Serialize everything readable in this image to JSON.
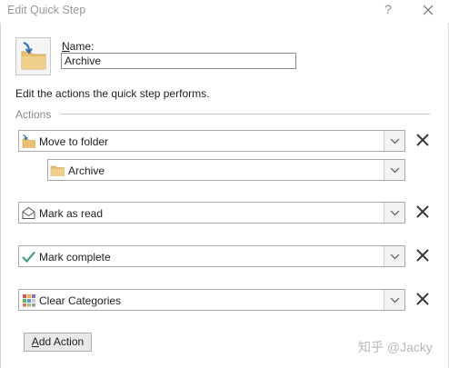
{
  "window": {
    "title": "Edit Quick Step",
    "help_label": "?"
  },
  "quick_step": {
    "icon": "move-to-folder-icon",
    "name_label": "Name:",
    "name_value": "Archive"
  },
  "description": "Edit the actions the quick step performs.",
  "actions_heading": "Actions",
  "actions": [
    {
      "label": "Move to folder",
      "icon": "move-to-folder-icon",
      "sub_value": "Archive",
      "sub_icon": "folder-icon"
    },
    {
      "label": "Mark as read",
      "icon": "open-envelope-icon"
    },
    {
      "label": "Mark complete",
      "icon": "checkmark-icon"
    },
    {
      "label": "Clear Categories",
      "icon": "categories-icon"
    }
  ],
  "add_action_label": "Add Action",
  "watermark": "知乎 @Jacky",
  "colors": {
    "folder": "#e8c172",
    "checkmark": "#4a9e7b",
    "arrow": "#2b6fb5"
  }
}
